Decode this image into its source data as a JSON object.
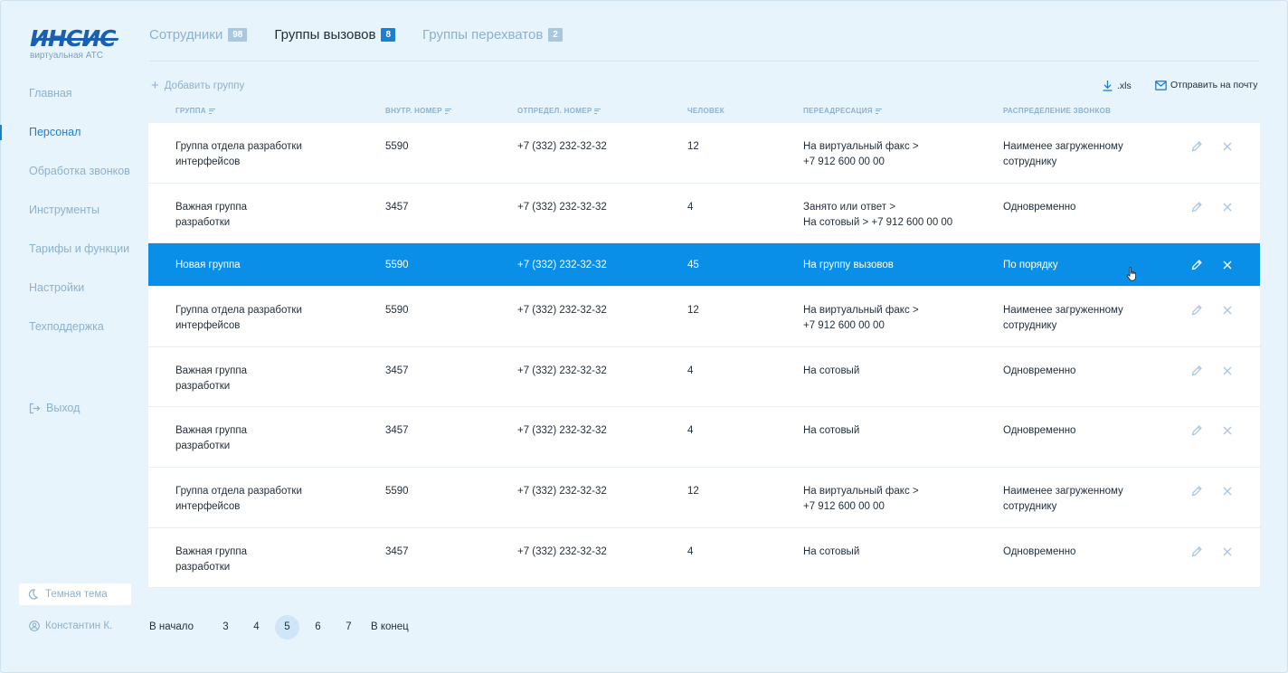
{
  "logo": {
    "mark": "ИНСИС",
    "subtitle": "виртуальная АТС"
  },
  "sidebar": {
    "items": [
      {
        "label": "Главная",
        "active": false
      },
      {
        "label": "Персонал",
        "active": true
      },
      {
        "label": "Обработка звонков",
        "active": false
      },
      {
        "label": "Инструменты",
        "active": false
      },
      {
        "label": "Тарифы и функции",
        "active": false
      },
      {
        "label": "Настройки",
        "active": false
      },
      {
        "label": "Техподдержка",
        "active": false
      }
    ],
    "logout_label": "Выход",
    "theme_label": "Темная тема",
    "user_name": "Константин К."
  },
  "tabs": [
    {
      "label": "Сотрудники",
      "count": "98",
      "active": false
    },
    {
      "label": "Группы вызовов",
      "count": "8",
      "active": true
    },
    {
      "label": "Группы перехватов",
      "count": "2",
      "active": false
    }
  ],
  "toolbar": {
    "add_label": "Добавить группу",
    "xls_label": ".xls",
    "email_label": "Отправить на почту"
  },
  "columns": [
    {
      "label": "ГРУППА",
      "sortable": true
    },
    {
      "label": "ВНУТР. НОМЕР",
      "sortable": true
    },
    {
      "label": "ОТПРЕДЕЛ. НОМЕР",
      "sortable": true
    },
    {
      "label": "ЧЕЛОВЕК",
      "sortable": false
    },
    {
      "label": "ПЕРЕАДРЕСАЦИЯ",
      "sortable": true
    },
    {
      "label": "РАСПРЕДЕЛЕНИЕ ЗВОНКОВ",
      "sortable": false
    }
  ],
  "rows": [
    {
      "group": "Группа отдела разработки\nинтерфейсов",
      "ext": "5590",
      "number": "+7 (332) 232-32-32",
      "people": "12",
      "forward": "На виртуальный факс >\n+7 912 600 00 00",
      "distribution": "Наименее загруженному\nсотруднику",
      "selected": false
    },
    {
      "group": "Важная группа\nразработки",
      "ext": "3457",
      "number": "+7 (332) 232-32-32",
      "people": "4",
      "forward": "Занято или ответ >\nНа сотовый > +7 912 600 00 00",
      "distribution": "Одновременно",
      "selected": false
    },
    {
      "group": "Новая группа",
      "ext": "5590",
      "number": "+7 (332) 232-32-32",
      "people": "45",
      "forward": "На группу вызовов",
      "distribution": "По порядку",
      "selected": true
    },
    {
      "group": "Группа отдела разработки\nинтерфейсов",
      "ext": "5590",
      "number": "+7 (332) 232-32-32",
      "people": "12",
      "forward": "На виртуальный факс >\n+7 912 600 00 00",
      "distribution": "Наименее загруженному\nсотруднику",
      "selected": false
    },
    {
      "group": "Важная группа\nразработки",
      "ext": "3457",
      "number": "+7 (332) 232-32-32",
      "people": "4",
      "forward": "На сотовый",
      "distribution": "Одновременно",
      "selected": false
    },
    {
      "group": "Важная группа\nразработки",
      "ext": "3457",
      "number": "+7 (332) 232-32-32",
      "people": "4",
      "forward": "На сотовый",
      "distribution": "Одновременно",
      "selected": false
    },
    {
      "group": "Группа отдела разработки\nинтерфейсов",
      "ext": "5590",
      "number": "+7 (332) 232-32-32",
      "people": "12",
      "forward": "На виртуальный факс >\n+7 912 600 00 00",
      "distribution": "Наименее загруженному\nсотруднику",
      "selected": false
    },
    {
      "group": "Важная группа\nразработки",
      "ext": "3457",
      "number": "+7 (332) 232-32-32",
      "people": "4",
      "forward": "На сотовый",
      "distribution": "Одновременно",
      "selected": false
    }
  ],
  "pagination": {
    "first_label": "В начало",
    "last_label": "В конец",
    "pages": [
      "3",
      "4",
      "5",
      "6",
      "7"
    ],
    "current": "5"
  },
  "colors": {
    "accent": "#1b7fd4",
    "selected_row": "#0a8fe8",
    "muted_text": "#8cb1ce",
    "background": "#e8f4fc"
  }
}
